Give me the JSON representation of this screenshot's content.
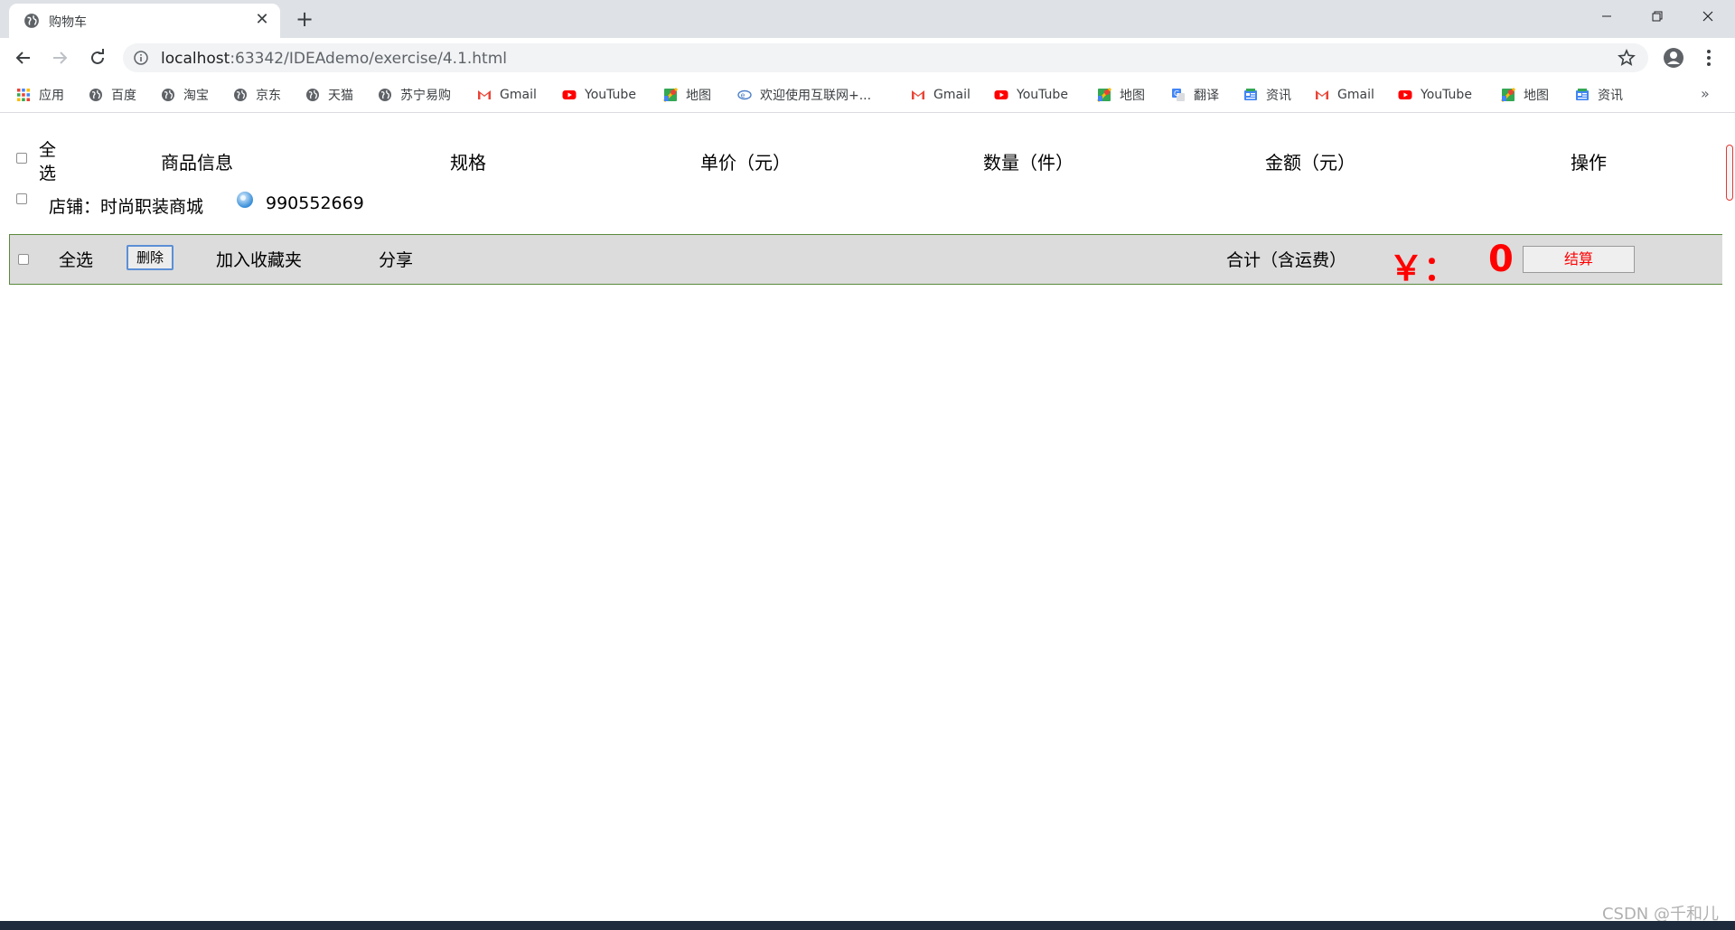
{
  "browser": {
    "tab_title": "购物车",
    "tab_close": "✕",
    "new_tab": "+",
    "url_host": "localhost",
    "url_rest": ":63342/IDEAdemo/exercise/4.1.html"
  },
  "bookmarks": [
    {
      "label": "应用",
      "icon": "apps-grid-icon"
    },
    {
      "label": "百度",
      "icon": "globe-icon"
    },
    {
      "label": "淘宝",
      "icon": "globe-icon"
    },
    {
      "label": "京东",
      "icon": "globe-icon"
    },
    {
      "label": "天猫",
      "icon": "globe-icon"
    },
    {
      "label": "苏宁易购",
      "icon": "globe-icon"
    },
    {
      "label": "Gmail",
      "icon": "gmail-icon"
    },
    {
      "label": "YouTube",
      "icon": "youtube-icon"
    },
    {
      "label": "地图",
      "icon": "maps-icon"
    },
    {
      "label": "欢迎使用互联网+...",
      "icon": "portal-icon"
    },
    {
      "label": "Gmail",
      "icon": "gmail-icon"
    },
    {
      "label": "YouTube",
      "icon": "youtube-icon"
    },
    {
      "label": "地图",
      "icon": "maps-icon"
    },
    {
      "label": "翻译",
      "icon": "translate-icon"
    },
    {
      "label": "资讯",
      "icon": "news-icon"
    },
    {
      "label": "Gmail",
      "icon": "gmail-icon"
    },
    {
      "label": "YouTube",
      "icon": "youtube-icon"
    },
    {
      "label": "地图",
      "icon": "maps-icon"
    },
    {
      "label": "资讯",
      "icon": "news-icon"
    }
  ],
  "bookmarks_more": "»",
  "cart": {
    "header": {
      "select_all": "全选",
      "product_info": "商品信息",
      "spec": "规格",
      "unit_price": "单价（元）",
      "quantity": "数量（件）",
      "amount": "金额（元）",
      "operation": "操作"
    },
    "shop": {
      "label": "店铺：时尚职装商城",
      "contact": "990552669"
    },
    "footer": {
      "select_all": "全选",
      "delete": "删除",
      "add_favorites": "加入收藏夹",
      "share": "分享",
      "total_label": "合计（含运费）",
      "currency": "￥：",
      "total_value": "0",
      "checkout": "结算"
    }
  },
  "watermark": "CSDN @千和儿",
  "colors": {
    "accent_red": "#ff0000",
    "bar_bg": "#dcdcdc",
    "bar_border": "#5a8a3c"
  }
}
